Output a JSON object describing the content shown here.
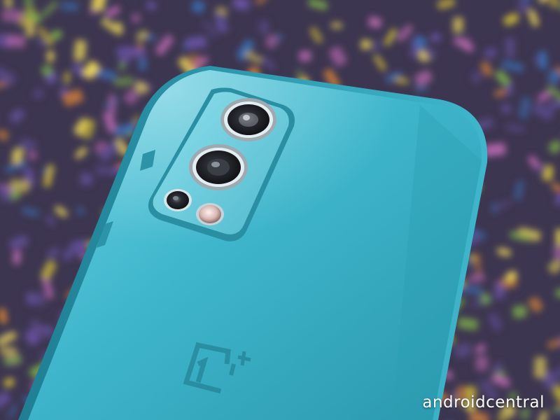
{
  "photo": {
    "subject": "phone-back-with-camera-module",
    "colors": {
      "phone_body": "#3fb6cc",
      "phone_highlight": "#7fdbe8",
      "phone_shadow": "#1f7e93",
      "camera_module": "#5fc3d6",
      "lens_ring": "#c9d6dc",
      "background_purple": "#5a4c8c",
      "background_yellow": "#c9b63a",
      "background_orange": "#d0803a",
      "background_blue": "#3b6db0",
      "background_pink": "#b066a8",
      "background_green": "#7aa84a"
    },
    "logo": {
      "brand_text": "1+"
    },
    "watermark": {
      "text": "androidcentral"
    }
  }
}
